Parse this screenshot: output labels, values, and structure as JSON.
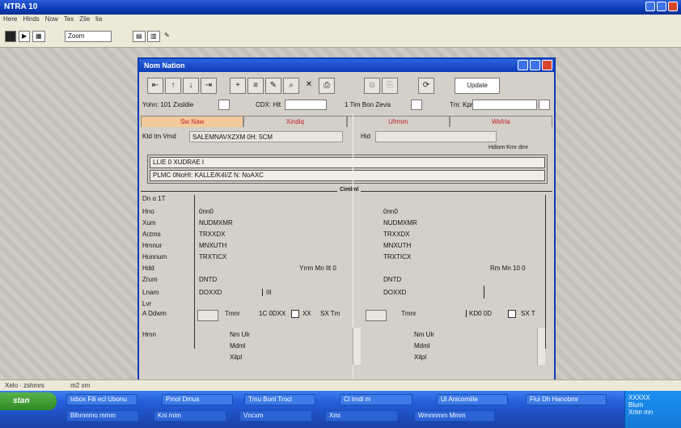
{
  "app": {
    "title": "NTRA 10",
    "menu": [
      "Here",
      "Hinds",
      "Now",
      "Tex",
      "Zile",
      "lia"
    ],
    "toolbar_box_1": "Zoom",
    "status_left": "Xelo · zshmrs",
    "status_mid": "m2 xm"
  },
  "dialog": {
    "title": "Nom Nation",
    "update_label": "Update",
    "filter": {
      "label_1": "Yohn: 101 Zxsldie",
      "label_2": "CDX: Hlt",
      "label_3": "1 Tim Bon Zevis",
      "label_4": "Tm: Kpr"
    },
    "tabs": [
      {
        "label": "Sw Naw"
      },
      {
        "label": "Xindiq"
      },
      {
        "label": "Ufrmm"
      },
      {
        "label": "Wefrla"
      }
    ],
    "address": {
      "label": "Ktd tm Vmd",
      "value": "SALEMNAVXZXM 0H: 5CM",
      "label_2": "Hid",
      "value_2": ""
    },
    "right_note": "Hdiom Kmr dmr",
    "list_items": [
      "LLIE 0 XUDRAE I",
      "PLMC 0NoHI: KALLE/K4I/Z N: NoAXC"
    ],
    "separator_label": "Cimlml"
  },
  "fields": {
    "header": "Dn o 1T",
    "rows": [
      {
        "label": "Hno",
        "left": "0nn0",
        "right": "0nn0"
      },
      {
        "label": "Xum",
        "left": "NUDMXMR",
        "right": "NUDMXMR"
      },
      {
        "label": "Arzms",
        "left": "TRXXDX",
        "right": "TRXXDX"
      },
      {
        "label": "Hmnur",
        "left": "MNXUTH",
        "right": "MNXUTH"
      },
      {
        "label": "Hunnum",
        "left": "TRXTICX",
        "right": "TRXTICX"
      },
      {
        "label": "Hdd",
        "left": "",
        "right": ""
      },
      {
        "label": "Zrum",
        "left": "DNTD",
        "right": "DNTD"
      },
      {
        "label": "Lnarn",
        "left": "DOXXD",
        "right": "DOXXD"
      },
      {
        "label": "Lvr",
        "left": "",
        "right": ""
      },
      {
        "label": "A Ddwm",
        "left": "",
        "right": ""
      },
      {
        "label": "Hmn",
        "left": "",
        "right": ""
      }
    ],
    "hdd_left_note": "Yrrm Mn Ilt 0",
    "hdd_right_note": "Rm Mn 10 0",
    "zrum_left_extra": "III",
    "bottom_left": {
      "tmnr": "Tmnr",
      "code": "1C 0DXX",
      "chk": "XX",
      "sx": "SX Tm",
      "nmdr": "Nm Ulr",
      "mdml": "Mdml",
      "xilpl": "Xilpl"
    },
    "bottom_right": {
      "tmnr": "Tmnr",
      "code": "KD0 0D",
      "chk": "XX",
      "sx": "SX T",
      "nmdr": "Nm Ulr",
      "mdml": "Mdml",
      "xilpl": "Xilpl"
    }
  },
  "taskbar": {
    "start": "stan",
    "row1": [
      "Ixbox Fili ecl Ubonu",
      "Pmol Dmus",
      "Tmu Bonl Trocl",
      "Cl lmdl m",
      "Ul Anicomiile",
      "Flui Dh Hanobmr"
    ],
    "row2": [
      "Blhmnmo mmm",
      "Kni mim",
      "Vncxm",
      "Xmi",
      "Wmnnmm Mmm"
    ],
    "tray": [
      "XXXXX",
      "Blum",
      "Xrtm mn"
    ]
  }
}
